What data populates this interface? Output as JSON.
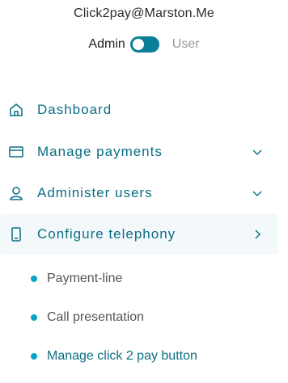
{
  "account": {
    "email": "Click2pay@Marston.Me"
  },
  "role_switch": {
    "left_label": "Admin",
    "right_label": "User",
    "selected": "Admin"
  },
  "nav": {
    "items": [
      {
        "label": "Dashboard",
        "icon": "home-icon"
      },
      {
        "label": "Manage payments",
        "icon": "credit-card-icon",
        "chevron": "chevron-down-icon"
      },
      {
        "label": "Administer users",
        "icon": "user-icon",
        "chevron": "chevron-down-icon"
      },
      {
        "label": "Configure telephony",
        "icon": "phone-icon",
        "chevron": "chevron-right-icon",
        "active": true
      }
    ],
    "subitems": [
      {
        "label": "Payment-line"
      },
      {
        "label": "Call presentation"
      },
      {
        "label": "Manage click 2 pay button",
        "active": true
      }
    ]
  },
  "colors": {
    "accent": "#0b6e85",
    "toggle": "#0b7e98",
    "bullet": "#0aa5c5",
    "active_bg": "#f3f8fb"
  }
}
